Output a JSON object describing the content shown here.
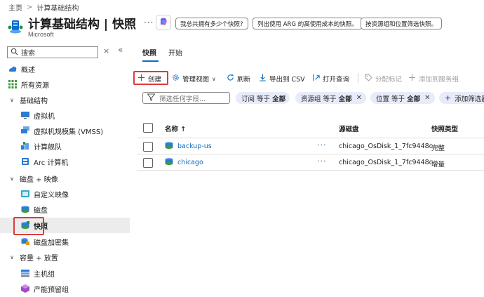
{
  "breadcrumb": {
    "home": "主页",
    "separator": ">",
    "current": "计算基础结构"
  },
  "header": {
    "title": "计算基础结构 | 快照",
    "subtitle": "Microsoft",
    "more": "···",
    "suggestions": [
      "我总共拥有多少个快照?",
      "列出使用 ARG 的高使用成本的快照。",
      "按资源组和位置筛选快照。"
    ]
  },
  "sidebar": {
    "search_placeholder": "搜索",
    "collapse_x": "×",
    "collapse_arrows": "«",
    "items": [
      {
        "label": "概述",
        "icon": "overview-icon"
      },
      {
        "label": "所有资源",
        "icon": "grid-icon"
      },
      {
        "label": "基础结构",
        "icon": "chevron-down-icon",
        "group": true
      },
      {
        "label": "虚拟机",
        "icon": "vm-icon"
      },
      {
        "label": "虚拟机规模集 (VMSS)",
        "icon": "vmss-icon"
      },
      {
        "label": "计算舰队",
        "icon": "fleet-icon"
      },
      {
        "label": "Arc 计算机",
        "icon": "arc-icon"
      },
      {
        "label": "磁盘 + 映像",
        "icon": "chevron-down-icon",
        "group": true
      },
      {
        "label": "自定义映像",
        "icon": "image-icon"
      },
      {
        "label": "磁盘",
        "icon": "disk-icon"
      },
      {
        "label": "快照",
        "icon": "snapshot-icon",
        "selected": true
      },
      {
        "label": "磁盘加密集",
        "icon": "encryption-icon"
      },
      {
        "label": "容量 + 放置",
        "icon": "chevron-down-icon",
        "group": true
      },
      {
        "label": "主机组",
        "icon": "host-icon"
      },
      {
        "label": "产能预留组",
        "icon": "capacity-icon"
      }
    ]
  },
  "tabs": [
    {
      "label": "快照",
      "active": true
    },
    {
      "label": "开始",
      "active": false
    }
  ],
  "toolbar": {
    "create": "创建",
    "manage_view": "管理视图",
    "refresh": "刷新",
    "export_csv": "导出到 CSV",
    "open_query": "打开查询",
    "assign_tags": "分配标记",
    "add_to_service_group": "添加到服务组"
  },
  "filters": {
    "placeholder": "筛选任何字段...",
    "pills": [
      {
        "name": "订阅",
        "op": "等于",
        "value": "全部"
      },
      {
        "name": "资源组",
        "op": "等于",
        "value": "全部"
      },
      {
        "name": "位置",
        "op": "等于",
        "value": "全部"
      }
    ],
    "add_filter": "添加筛选器"
  },
  "table": {
    "columns": [
      "名称 ↑",
      "源磁盘",
      "快照类型"
    ],
    "rows": [
      {
        "name": "backup-us",
        "more": "···",
        "source": "chicago_OsDisk_1_7fc9448c...",
        "type": "完整"
      },
      {
        "name": "chicago",
        "more": "···",
        "source": "chicago_OsDisk_1_7fc9448c...",
        "type": "增量"
      }
    ]
  },
  "colors": {
    "accent": "#0f6cbd",
    "highlight_box": "#e03a3a",
    "selected_bg": "#ececec",
    "pill_bg": "#e8ebfa"
  }
}
